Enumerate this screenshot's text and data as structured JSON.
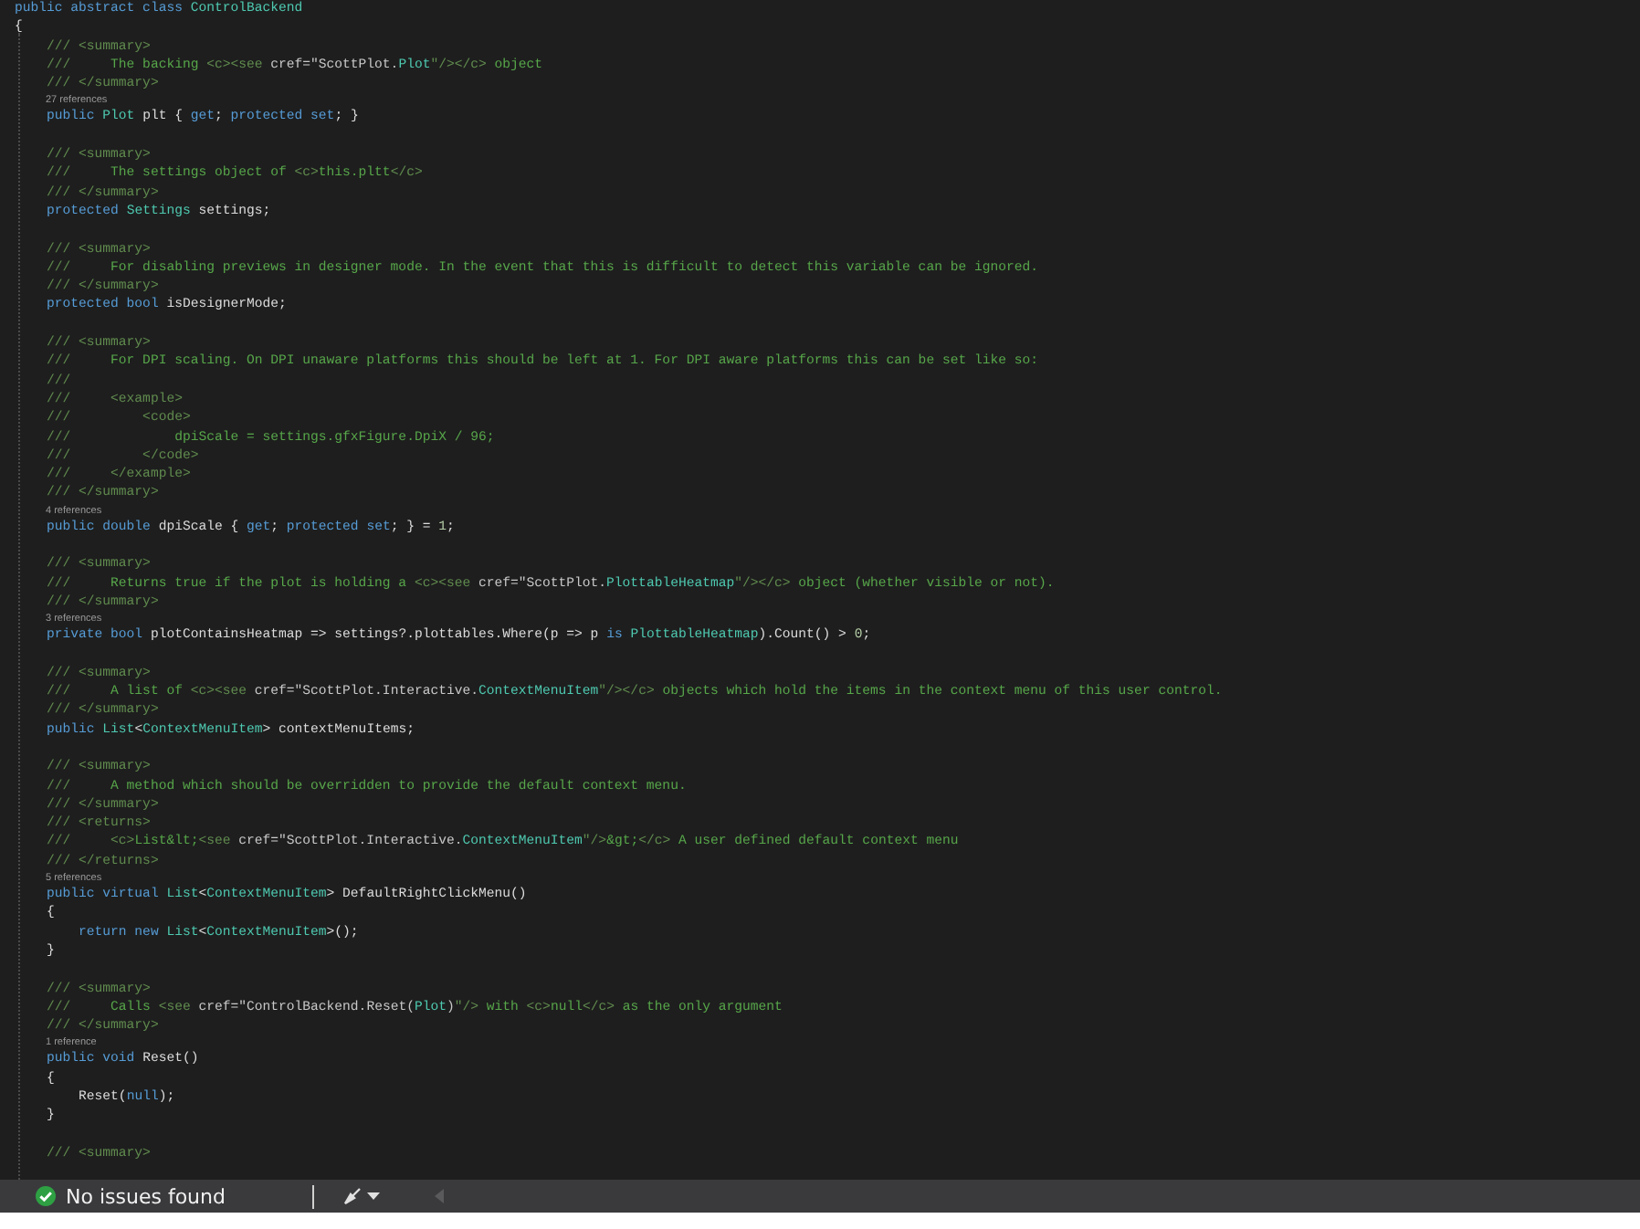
{
  "editor": {
    "lines": [
      {
        "kind": "code",
        "tokens": [
          {
            "kind": "kw",
            "text": "public abstract class "
          },
          {
            "kind": "type",
            "text": "ControlBackend"
          }
        ]
      },
      {
        "kind": "code",
        "tokens": [
          {
            "kind": "id",
            "text": "{"
          }
        ]
      },
      {
        "kind": "code",
        "tokens": [
          {
            "kind": "doc",
            "text": "    /// <summary>"
          }
        ]
      },
      {
        "kind": "code",
        "tokens": [
          {
            "kind": "doc",
            "text": "    ///     "
          },
          {
            "kind": "text",
            "text": "The backing "
          },
          {
            "kind": "doc",
            "text": "<c><see "
          },
          {
            "kind": "attr",
            "text": "cref=\"ScottPlot."
          },
          {
            "kind": "type",
            "text": "Plot"
          },
          {
            "kind": "doc",
            "text": "\"/></c>"
          },
          {
            "kind": "text",
            "text": " object"
          }
        ]
      },
      {
        "kind": "code",
        "tokens": [
          {
            "kind": "doc",
            "text": "    /// </summary>"
          }
        ]
      },
      {
        "kind": "lens",
        "text": "27 references"
      },
      {
        "kind": "code",
        "tokens": [
          {
            "kind": "kw",
            "text": "    public "
          },
          {
            "kind": "type",
            "text": "Plot "
          },
          {
            "kind": "id",
            "text": "plt { "
          },
          {
            "kind": "kw",
            "text": "get"
          },
          {
            "kind": "id",
            "text": "; "
          },
          {
            "kind": "kw",
            "text": "protected set"
          },
          {
            "kind": "id",
            "text": "; }"
          }
        ]
      },
      {
        "kind": "blank"
      },
      {
        "kind": "code",
        "tokens": [
          {
            "kind": "doc",
            "text": "    /// <summary>"
          }
        ]
      },
      {
        "kind": "code",
        "tokens": [
          {
            "kind": "doc",
            "text": "    ///     "
          },
          {
            "kind": "text",
            "text": "The settings object of "
          },
          {
            "kind": "doc",
            "text": "<c>"
          },
          {
            "kind": "text",
            "text": "this.pltt"
          },
          {
            "kind": "doc",
            "text": "</c>"
          }
        ]
      },
      {
        "kind": "code",
        "tokens": [
          {
            "kind": "doc",
            "text": "    /// </summary>"
          }
        ]
      },
      {
        "kind": "code",
        "tokens": [
          {
            "kind": "kw",
            "text": "    protected "
          },
          {
            "kind": "type",
            "text": "Settings "
          },
          {
            "kind": "id",
            "text": "settings;"
          }
        ]
      },
      {
        "kind": "blank"
      },
      {
        "kind": "code",
        "tokens": [
          {
            "kind": "doc",
            "text": "    /// <summary>"
          }
        ]
      },
      {
        "kind": "code",
        "tokens": [
          {
            "kind": "doc",
            "text": "    ///     "
          },
          {
            "kind": "text",
            "text": "For disabling previews in designer mode. In the event that this is difficult to detect this variable can be ignored."
          }
        ]
      },
      {
        "kind": "code",
        "tokens": [
          {
            "kind": "doc",
            "text": "    /// </summary>"
          }
        ]
      },
      {
        "kind": "code",
        "tokens": [
          {
            "kind": "kw",
            "text": "    protected bool "
          },
          {
            "kind": "id",
            "text": "isDesignerMode;"
          }
        ]
      },
      {
        "kind": "blank"
      },
      {
        "kind": "code",
        "tokens": [
          {
            "kind": "doc",
            "text": "    /// <summary>"
          }
        ]
      },
      {
        "kind": "code",
        "tokens": [
          {
            "kind": "doc",
            "text": "    ///     "
          },
          {
            "kind": "text",
            "text": "For DPI scaling. On DPI unaware platforms this should be left at 1. For DPI aware platforms this can be set like so:"
          }
        ]
      },
      {
        "kind": "code",
        "tokens": [
          {
            "kind": "doc",
            "text": "    ///"
          }
        ]
      },
      {
        "kind": "code",
        "tokens": [
          {
            "kind": "doc",
            "text": "    ///     <example>"
          }
        ]
      },
      {
        "kind": "code",
        "tokens": [
          {
            "kind": "doc",
            "text": "    ///         <code>"
          }
        ]
      },
      {
        "kind": "code",
        "tokens": [
          {
            "kind": "doc",
            "text": "    ///             "
          },
          {
            "kind": "text",
            "text": "dpiScale = settings.gfxFigure.DpiX / 96;"
          }
        ]
      },
      {
        "kind": "code",
        "tokens": [
          {
            "kind": "doc",
            "text": "    ///         </code>"
          }
        ]
      },
      {
        "kind": "code",
        "tokens": [
          {
            "kind": "doc",
            "text": "    ///     </example>"
          }
        ]
      },
      {
        "kind": "code",
        "tokens": [
          {
            "kind": "doc",
            "text": "    /// </summary>"
          }
        ]
      },
      {
        "kind": "lens",
        "text": "4 references"
      },
      {
        "kind": "code",
        "tokens": [
          {
            "kind": "kw",
            "text": "    public double "
          },
          {
            "kind": "id",
            "text": "dpiScale { "
          },
          {
            "kind": "kw",
            "text": "get"
          },
          {
            "kind": "id",
            "text": "; "
          },
          {
            "kind": "kw",
            "text": "protected set"
          },
          {
            "kind": "id",
            "text": "; } = "
          },
          {
            "kind": "num",
            "text": "1"
          },
          {
            "kind": "id",
            "text": ";"
          }
        ]
      },
      {
        "kind": "blank"
      },
      {
        "kind": "code",
        "tokens": [
          {
            "kind": "doc",
            "text": "    /// <summary>"
          }
        ]
      },
      {
        "kind": "code",
        "tokens": [
          {
            "kind": "doc",
            "text": "    ///     "
          },
          {
            "kind": "text",
            "text": "Returns true if the plot is holding a "
          },
          {
            "kind": "doc",
            "text": "<c><see "
          },
          {
            "kind": "attr",
            "text": "cref=\"ScottPlot."
          },
          {
            "kind": "type",
            "text": "PlottableHeatmap"
          },
          {
            "kind": "doc",
            "text": "\"/></c>"
          },
          {
            "kind": "text",
            "text": " object (whether visible or not)."
          }
        ]
      },
      {
        "kind": "code",
        "tokens": [
          {
            "kind": "doc",
            "text": "    /// </summary>"
          }
        ]
      },
      {
        "kind": "lens",
        "text": "3 references"
      },
      {
        "kind": "code",
        "tokens": [
          {
            "kind": "kw",
            "text": "    private bool "
          },
          {
            "kind": "id",
            "text": "plotContainsHeatmap => settings?.plottables.Where(p => p "
          },
          {
            "kind": "kw",
            "text": "is "
          },
          {
            "kind": "type",
            "text": "PlottableHeatmap"
          },
          {
            "kind": "id",
            "text": ").Count() > "
          },
          {
            "kind": "num",
            "text": "0"
          },
          {
            "kind": "id",
            "text": ";"
          }
        ]
      },
      {
        "kind": "blank"
      },
      {
        "kind": "code",
        "tokens": [
          {
            "kind": "doc",
            "text": "    /// <summary>"
          }
        ]
      },
      {
        "kind": "code",
        "tokens": [
          {
            "kind": "doc",
            "text": "    ///     "
          },
          {
            "kind": "text",
            "text": "A list of "
          },
          {
            "kind": "doc",
            "text": "<c><see "
          },
          {
            "kind": "attr",
            "text": "cref=\"ScottPlot.Interactive."
          },
          {
            "kind": "type",
            "text": "ContextMenuItem"
          },
          {
            "kind": "doc",
            "text": "\"/></c>"
          },
          {
            "kind": "text",
            "text": " objects which hold the items in the context menu of this user control."
          }
        ]
      },
      {
        "kind": "code",
        "tokens": [
          {
            "kind": "doc",
            "text": "    /// </summary>"
          }
        ]
      },
      {
        "kind": "code",
        "tokens": [
          {
            "kind": "kw",
            "text": "    public "
          },
          {
            "kind": "type",
            "text": "List"
          },
          {
            "kind": "id",
            "text": "<"
          },
          {
            "kind": "type",
            "text": "ContextMenuItem"
          },
          {
            "kind": "id",
            "text": "> contextMenuItems;"
          }
        ]
      },
      {
        "kind": "blank"
      },
      {
        "kind": "code",
        "tokens": [
          {
            "kind": "doc",
            "text": "    /// <summary>"
          }
        ]
      },
      {
        "kind": "code",
        "tokens": [
          {
            "kind": "doc",
            "text": "    ///     "
          },
          {
            "kind": "text",
            "text": "A method which should be overridden to provide the default context menu."
          }
        ]
      },
      {
        "kind": "code",
        "tokens": [
          {
            "kind": "doc",
            "text": "    /// </summary>"
          }
        ]
      },
      {
        "kind": "code",
        "tokens": [
          {
            "kind": "doc",
            "text": "    /// <returns>"
          }
        ]
      },
      {
        "kind": "code",
        "tokens": [
          {
            "kind": "doc",
            "text": "    ///     <c>"
          },
          {
            "kind": "text",
            "text": "List&lt;"
          },
          {
            "kind": "doc",
            "text": "<see "
          },
          {
            "kind": "attr",
            "text": "cref=\"ScottPlot.Interactive."
          },
          {
            "kind": "type",
            "text": "ContextMenuItem"
          },
          {
            "kind": "doc",
            "text": "\"/>"
          },
          {
            "kind": "text",
            "text": "&gt;"
          },
          {
            "kind": "doc",
            "text": "</c>"
          },
          {
            "kind": "text",
            "text": " A user defined default context menu"
          }
        ]
      },
      {
        "kind": "code",
        "tokens": [
          {
            "kind": "doc",
            "text": "    /// </returns>"
          }
        ]
      },
      {
        "kind": "lens",
        "text": "5 references"
      },
      {
        "kind": "code",
        "tokens": [
          {
            "kind": "kw",
            "text": "    public virtual "
          },
          {
            "kind": "type",
            "text": "List"
          },
          {
            "kind": "id",
            "text": "<"
          },
          {
            "kind": "type",
            "text": "ContextMenuItem"
          },
          {
            "kind": "id",
            "text": "> DefaultRightClickMenu()"
          }
        ]
      },
      {
        "kind": "code",
        "tokens": [
          {
            "kind": "id",
            "text": "    {"
          }
        ]
      },
      {
        "kind": "code",
        "tokens": [
          {
            "kind": "kw",
            "text": "        return new "
          },
          {
            "kind": "type",
            "text": "List"
          },
          {
            "kind": "id",
            "text": "<"
          },
          {
            "kind": "type",
            "text": "ContextMenuItem"
          },
          {
            "kind": "id",
            "text": ">();"
          }
        ]
      },
      {
        "kind": "code",
        "tokens": [
          {
            "kind": "id",
            "text": "    }"
          }
        ]
      },
      {
        "kind": "blank"
      },
      {
        "kind": "code",
        "tokens": [
          {
            "kind": "doc",
            "text": "    /// <summary>"
          }
        ]
      },
      {
        "kind": "code",
        "tokens": [
          {
            "kind": "doc",
            "text": "    ///     "
          },
          {
            "kind": "text",
            "text": "Calls "
          },
          {
            "kind": "doc",
            "text": "<see "
          },
          {
            "kind": "attr",
            "text": "cref=\"ControlBackend.Reset("
          },
          {
            "kind": "type",
            "text": "Plot"
          },
          {
            "kind": "attr",
            "text": ")"
          },
          {
            "kind": "doc",
            "text": "\"/>"
          },
          {
            "kind": "text",
            "text": " with "
          },
          {
            "kind": "doc",
            "text": "<c>"
          },
          {
            "kind": "text",
            "text": "null"
          },
          {
            "kind": "doc",
            "text": "</c>"
          },
          {
            "kind": "text",
            "text": " as the only argument"
          }
        ]
      },
      {
        "kind": "code",
        "tokens": [
          {
            "kind": "doc",
            "text": "    /// </summary>"
          }
        ]
      },
      {
        "kind": "lens",
        "text": "1 reference"
      },
      {
        "kind": "code",
        "tokens": [
          {
            "kind": "kw",
            "text": "    public void "
          },
          {
            "kind": "id",
            "text": "Reset()"
          }
        ]
      },
      {
        "kind": "code",
        "tokens": [
          {
            "kind": "id",
            "text": "    {"
          }
        ]
      },
      {
        "kind": "code",
        "tokens": [
          {
            "kind": "id",
            "text": "        Reset("
          },
          {
            "kind": "kw",
            "text": "null"
          },
          {
            "kind": "id",
            "text": ");"
          }
        ]
      },
      {
        "kind": "code",
        "tokens": [
          {
            "kind": "id",
            "text": "    }"
          }
        ]
      },
      {
        "kind": "blank"
      },
      {
        "kind": "code",
        "tokens": [
          {
            "kind": "doc",
            "text": "    /// <summary>"
          }
        ]
      }
    ]
  },
  "status_bar": {
    "message": "No issues found"
  }
}
